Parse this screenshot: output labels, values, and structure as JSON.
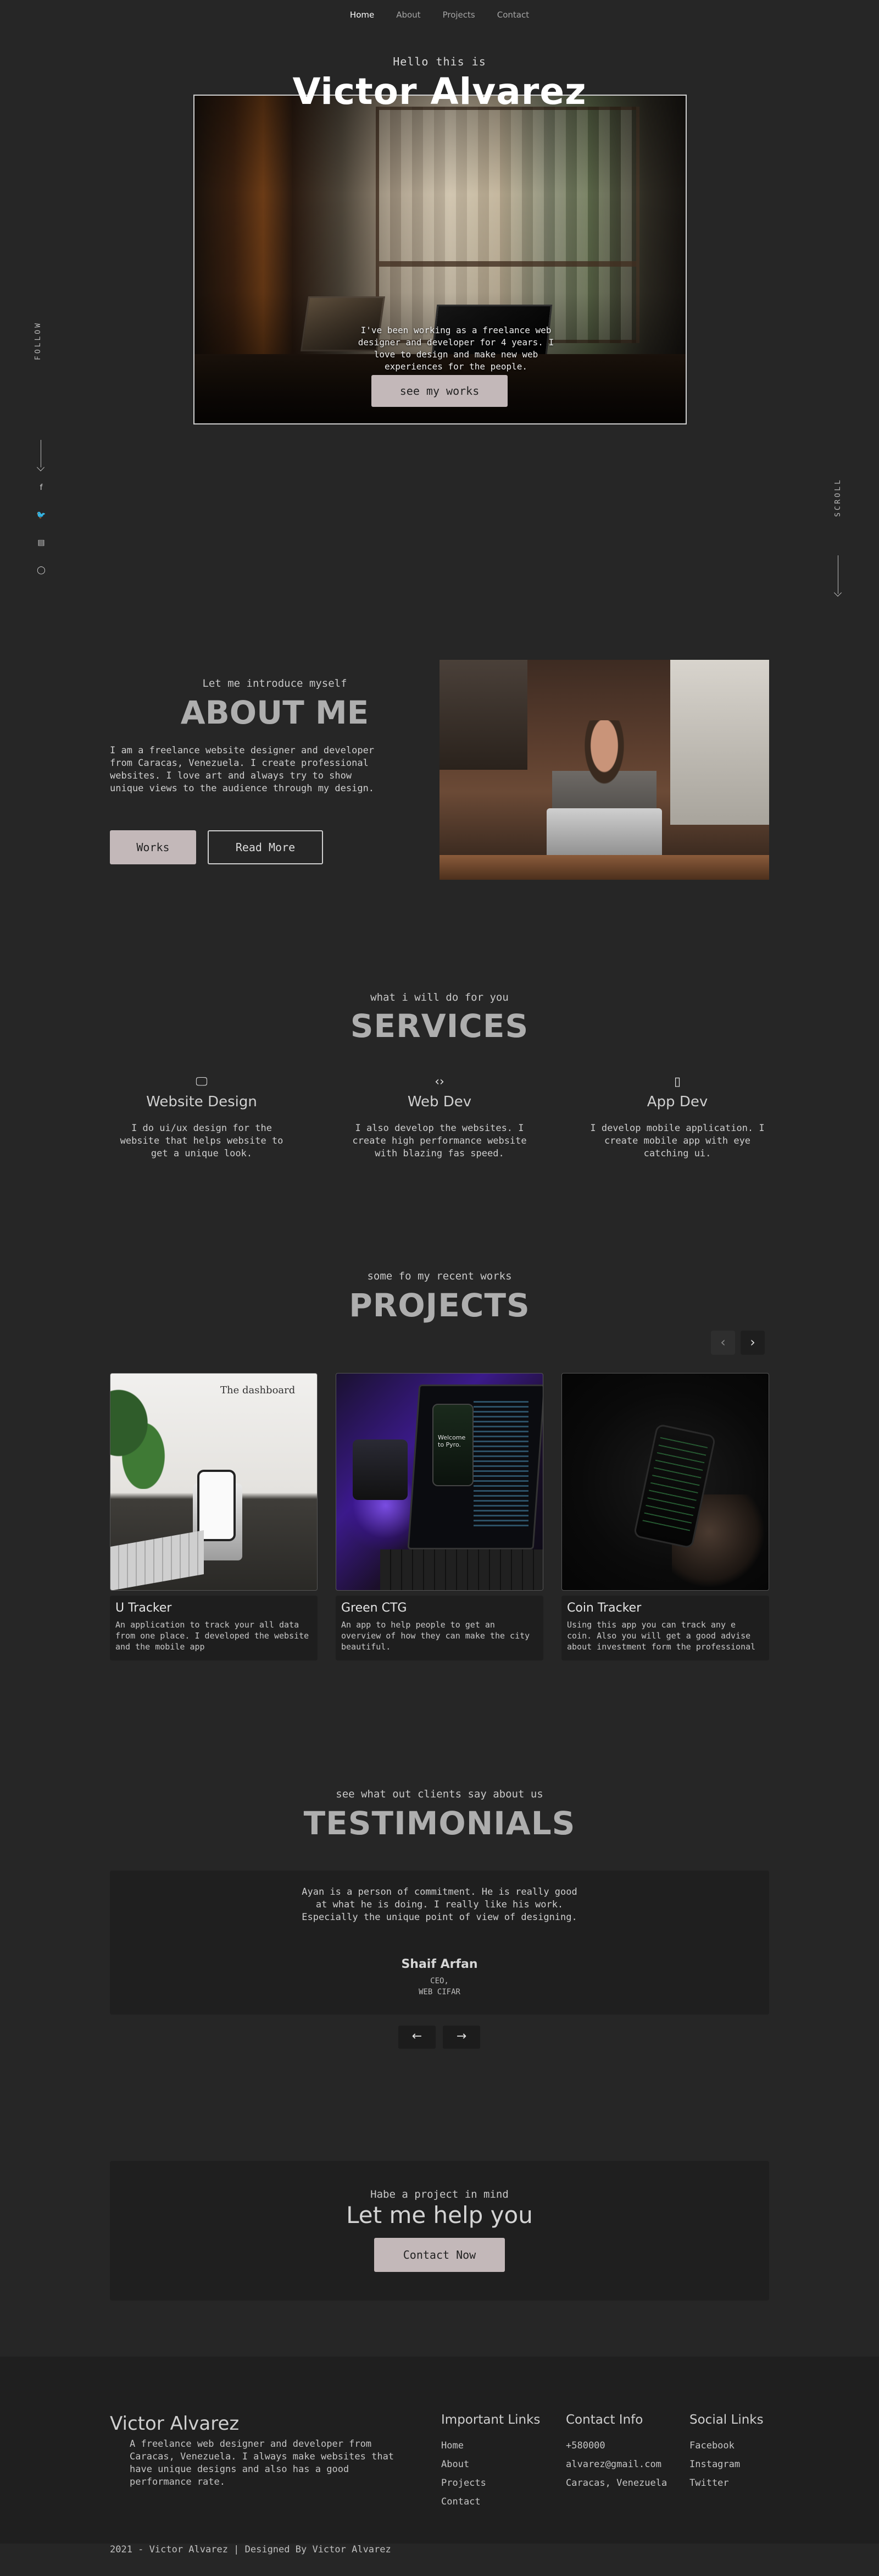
{
  "nav": {
    "items": [
      {
        "label": "Home"
      },
      {
        "label": "About"
      },
      {
        "label": "Projects"
      },
      {
        "label": "Contact"
      }
    ]
  },
  "hero": {
    "hello": "Hello this is",
    "name": "Victor Alvarez",
    "intro": "I've been working as a freelance web designer and developer for 4 years. I love to design and make new web experiences for the people.",
    "button_label": "see my works"
  },
  "side": {
    "follow_label": "FOLLOW",
    "scroll_label": "SCROLL",
    "socials": [
      "f",
      "🐦",
      "▤",
      "◯"
    ]
  },
  "about": {
    "subtitle": "Let me introduce myself",
    "title": "ABOUT ME",
    "text": "I am a freelance website designer and developer from Caracas, Venezuela. I create professional websites. I love art and always try to show unique views to the audience through my design.",
    "works_label": "Works",
    "read_more_label": "Read More"
  },
  "services": {
    "subtitle": "what i will do for you",
    "title": "SERVICES",
    "items": [
      {
        "icon": "monitor-icon",
        "glyph": "🖵",
        "name": "Website Design",
        "desc": "I do ui/ux design for the website that helps website to get a unique look."
      },
      {
        "icon": "code-icon",
        "glyph": "‹›",
        "name": "Web Dev",
        "desc": "I also develop the websites. I create high performance website with blazing fas speed."
      },
      {
        "icon": "mobile-icon",
        "glyph": "▯",
        "name": "App Dev",
        "desc": "I develop mobile application. I create mobile app with eye catching ui."
      }
    ]
  },
  "projects": {
    "subtitle": "some fo my recent works",
    "title": "PROJECTS",
    "items": [
      {
        "name": "U Tracker",
        "desc": "An application to track your all data from one place. I developed the website and the mobile app",
        "img_text": "The dashboard"
      },
      {
        "name": "Green CTG",
        "desc": "An app to help people to get an overview of how they can make the city beautiful.",
        "img_text": "Welcome to Pyro."
      },
      {
        "name": "Coin Tracker",
        "desc": "Using this app you can track any e coin. Also you will get a good advise about investment form the professional",
        "img_text": ""
      }
    ]
  },
  "testimonials": {
    "subtitle": "see what out clients say about us",
    "title": "TESTIMONIALS",
    "quote": "Ayan is a person of commitment. He is really good at what he is doing. I really like his work. Especially the unique point of view of designing.",
    "name": "Shaif Arfan",
    "role_line1": "CEO,",
    "role_line2": "WEB CIFAR"
  },
  "cta": {
    "subtitle": "Habe a project in mind",
    "title": "Let me help you",
    "button_label": "Contact Now"
  },
  "footer": {
    "brand": "Victor Alvarez",
    "about": "A freelance web designer and developer from Caracas, Venezuela. I always make websites that have unique designs and also has a good performance rate.",
    "important_title": "Important Links",
    "important_links": [
      "Home",
      "About",
      "Projects",
      "Contact"
    ],
    "contact_title": "Contact Info",
    "contact_items": [
      "+580000",
      "alvarez@gmail.com",
      "Caracas, Venezuela"
    ],
    "social_title": "Social Links",
    "social_links": [
      "Facebook",
      "Instagram",
      "Twitter"
    ],
    "copyright": "2021 - Victor Alvarez | Designed By Victor Alvarez"
  }
}
